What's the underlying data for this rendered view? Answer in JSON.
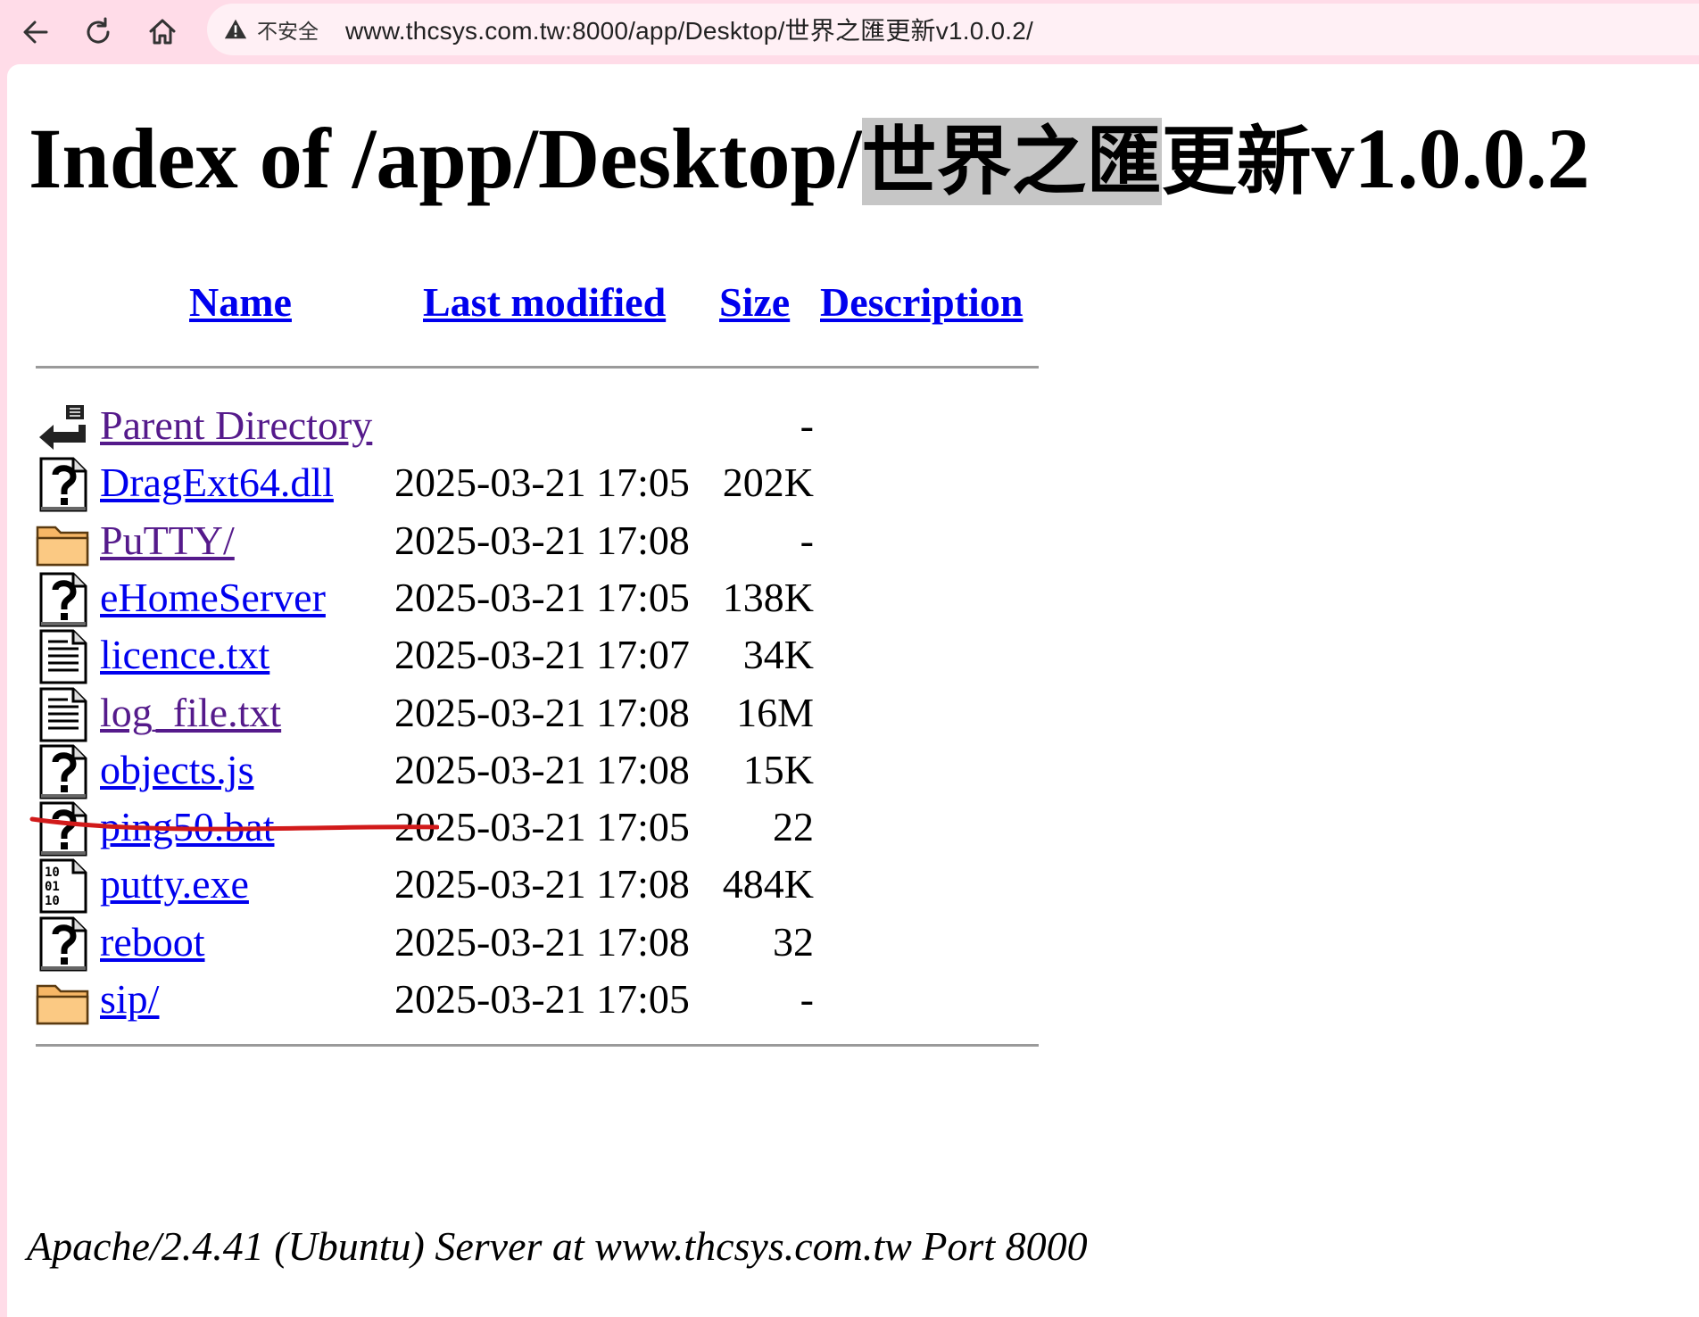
{
  "browser": {
    "insecure_label": "不安全",
    "url": "www.thcsys.com.tw:8000/app/Desktop/世界之匯更新v1.0.0.2/"
  },
  "page": {
    "title_prefix": "Index of /app/Desktop/",
    "title_highlighted": "世界之匯",
    "title_cjk_rest": "更新",
    "title_suffix": "v1.0.0.2",
    "headers": {
      "name": "Name",
      "last_modified": "Last modified",
      "size": "Size",
      "description": "Description"
    },
    "entries": [
      {
        "name": "Parent Directory",
        "date": "",
        "size": "-",
        "icon": "back-icon",
        "visited": true
      },
      {
        "name": "DragExt64.dll",
        "date": "2025-03-21 17:05",
        "size": "202K",
        "icon": "unknown-file-icon",
        "visited": false
      },
      {
        "name": "PuTTY/",
        "date": "2025-03-21 17:08",
        "size": "-",
        "icon": "folder-icon",
        "visited": true
      },
      {
        "name": "eHomeServer",
        "date": "2025-03-21 17:05",
        "size": "138K",
        "icon": "unknown-file-icon",
        "visited": false
      },
      {
        "name": "licence.txt",
        "date": "2025-03-21 17:07",
        "size": "34K",
        "icon": "text-file-icon",
        "visited": false
      },
      {
        "name": "log_file.txt",
        "date": "2025-03-21 17:08",
        "size": "16M",
        "icon": "text-file-icon",
        "visited": true
      },
      {
        "name": "objects.js",
        "date": "2025-03-21 17:08",
        "size": "15K",
        "icon": "unknown-file-icon",
        "visited": false
      },
      {
        "name": "ping50.bat",
        "date": "2025-03-21 17:05",
        "size": "22",
        "icon": "unknown-file-icon",
        "visited": false
      },
      {
        "name": "putty.exe",
        "date": "2025-03-21 17:08",
        "size": "484K",
        "icon": "binary-file-icon",
        "visited": false
      },
      {
        "name": "reboot",
        "date": "2025-03-21 17:08",
        "size": "32",
        "icon": "unknown-file-icon",
        "visited": false
      },
      {
        "name": "sip/",
        "date": "2025-03-21 17:05",
        "size": "-",
        "icon": "folder-icon",
        "visited": false
      }
    ],
    "footer": "Apache/2.4.41 (Ubuntu) Server at www.thcsys.com.tw Port 8000"
  },
  "colors": {
    "link": "#0000ee",
    "visited": "#551a8b",
    "annotation": "#d11a1a",
    "highlight": "#c6c6c6"
  }
}
